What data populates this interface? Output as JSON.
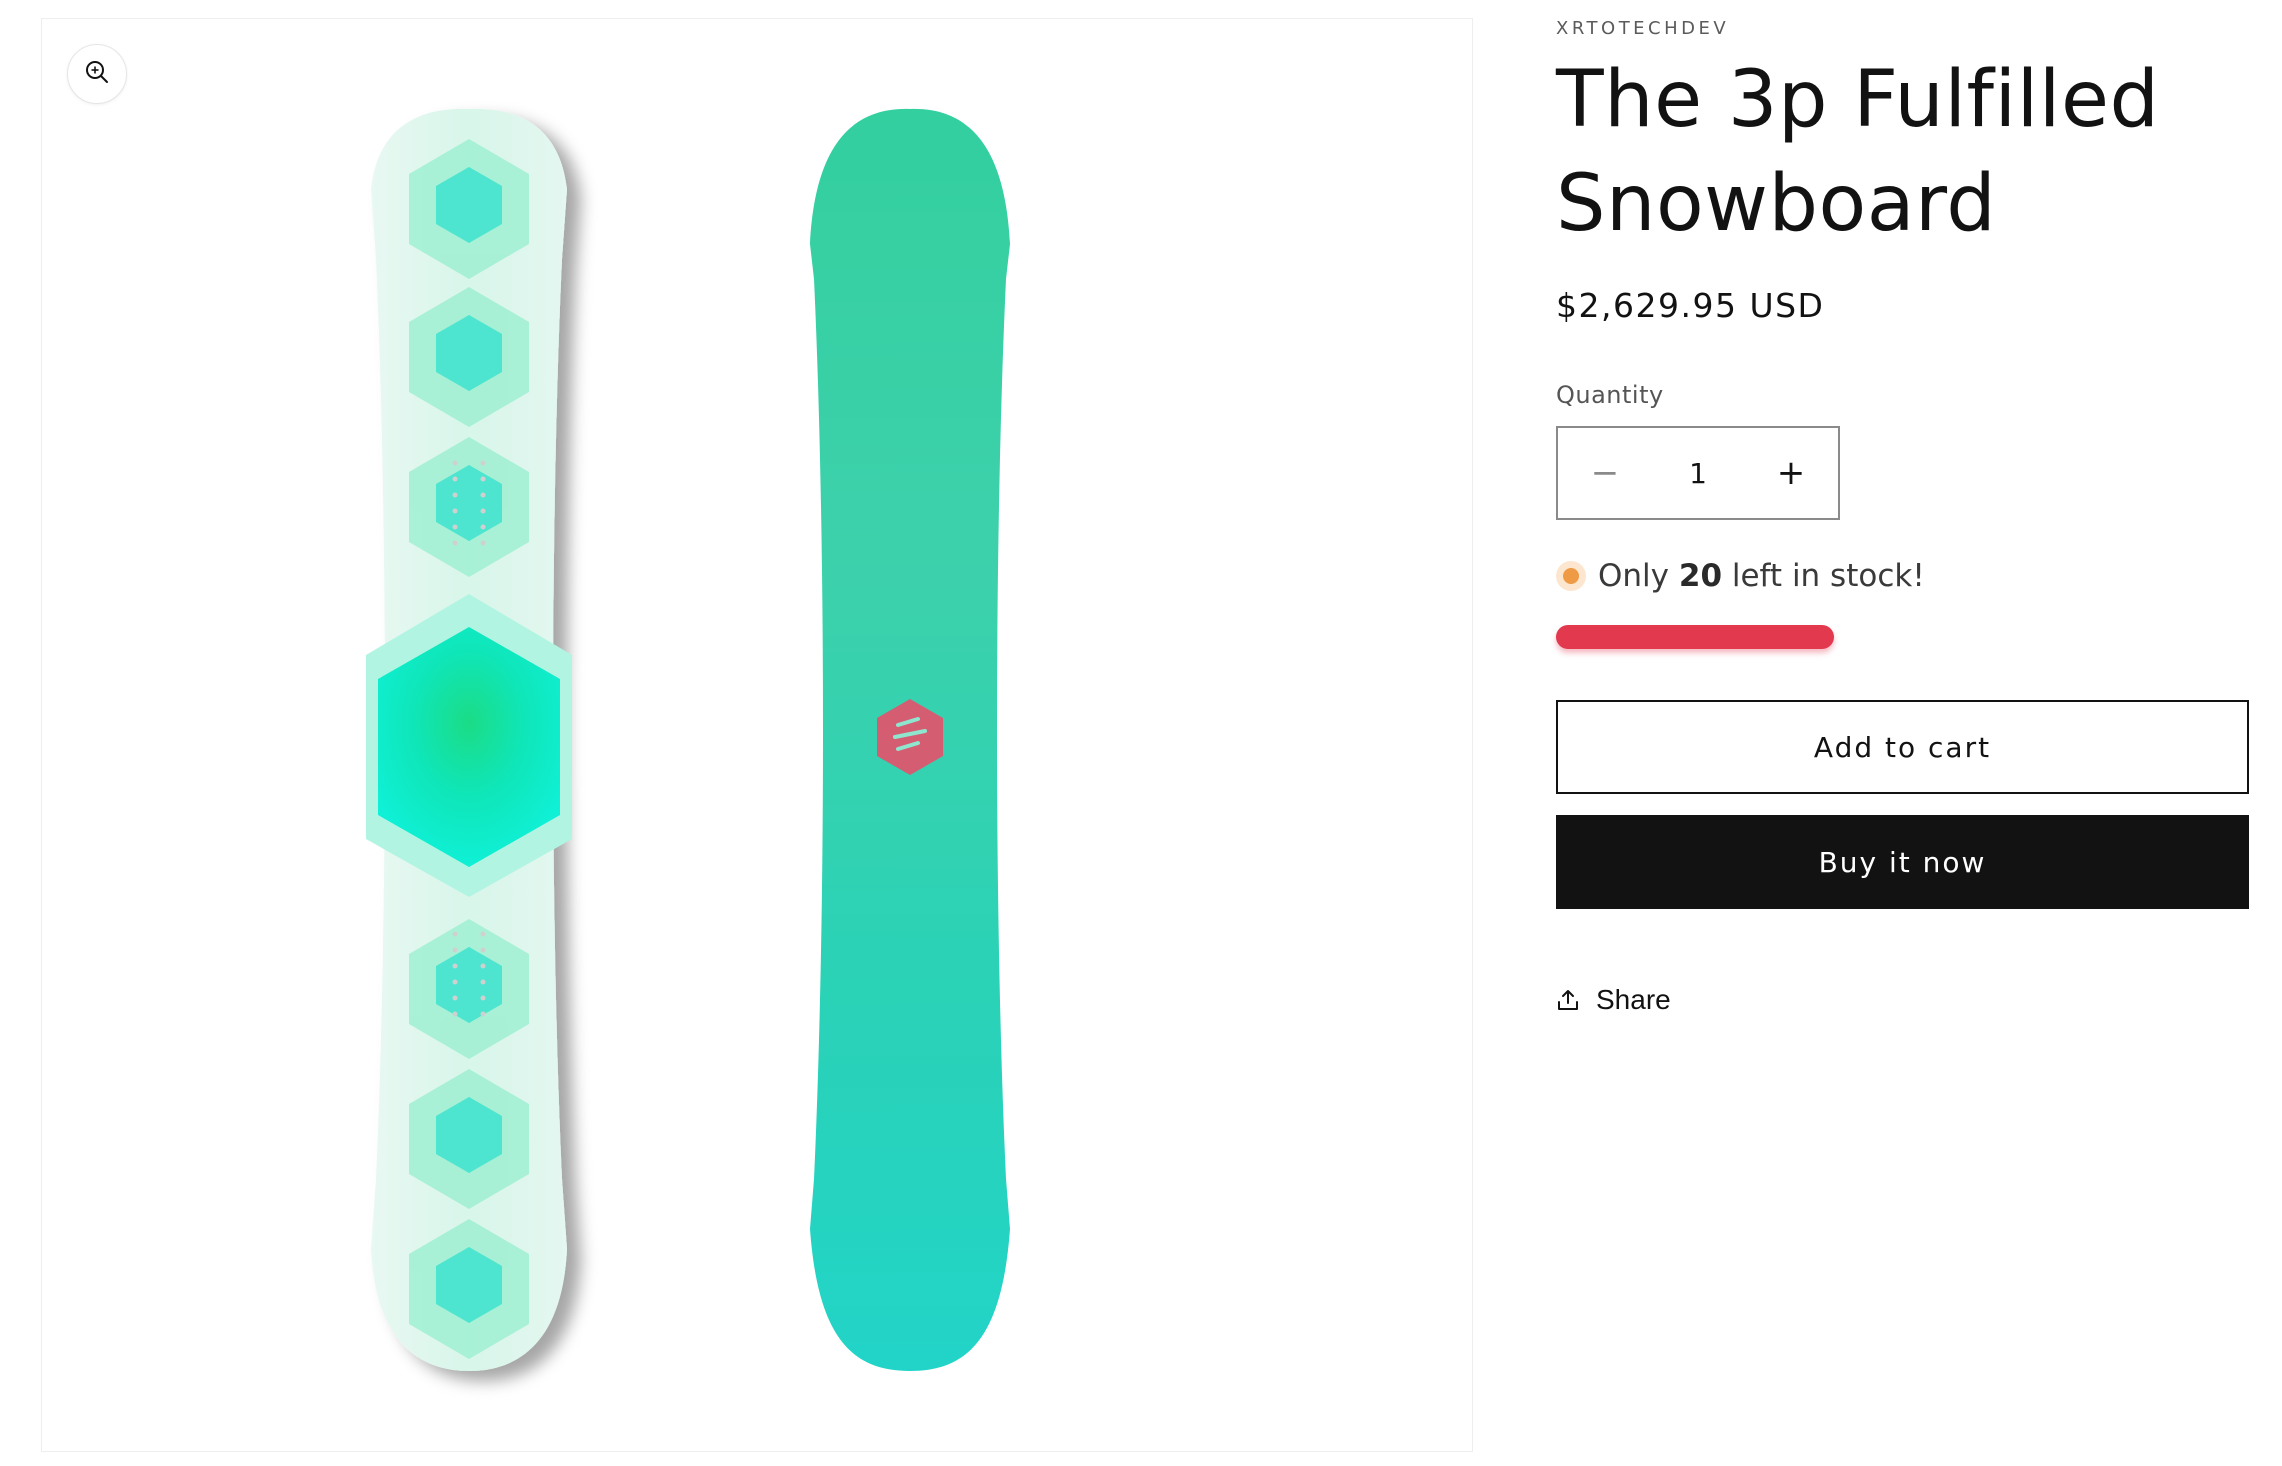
{
  "product": {
    "vendor": "XRTOTECHDEV",
    "title": "The 3p Fulfilled Snowboard",
    "price": "$2,629.95 USD"
  },
  "quantity": {
    "label": "Quantity",
    "value": "1",
    "decrease_glyph": "−",
    "increase_glyph": "+"
  },
  "stock": {
    "prefix": "Only",
    "count": "20",
    "suffix": "left in stock!",
    "level_fraction": 1.0,
    "dot_color": "#ef9a44",
    "bar_color": "#e2394f"
  },
  "actions": {
    "add_to_cart": "Add to cart",
    "buy_now": "Buy it now",
    "share": "Share"
  },
  "icons": {
    "zoom": "zoom-in-icon",
    "share": "share-icon"
  },
  "colors": {
    "board_light": "#dff7ee",
    "board_teal": "#2cd6b0",
    "hex_accent": "#e7506a"
  }
}
